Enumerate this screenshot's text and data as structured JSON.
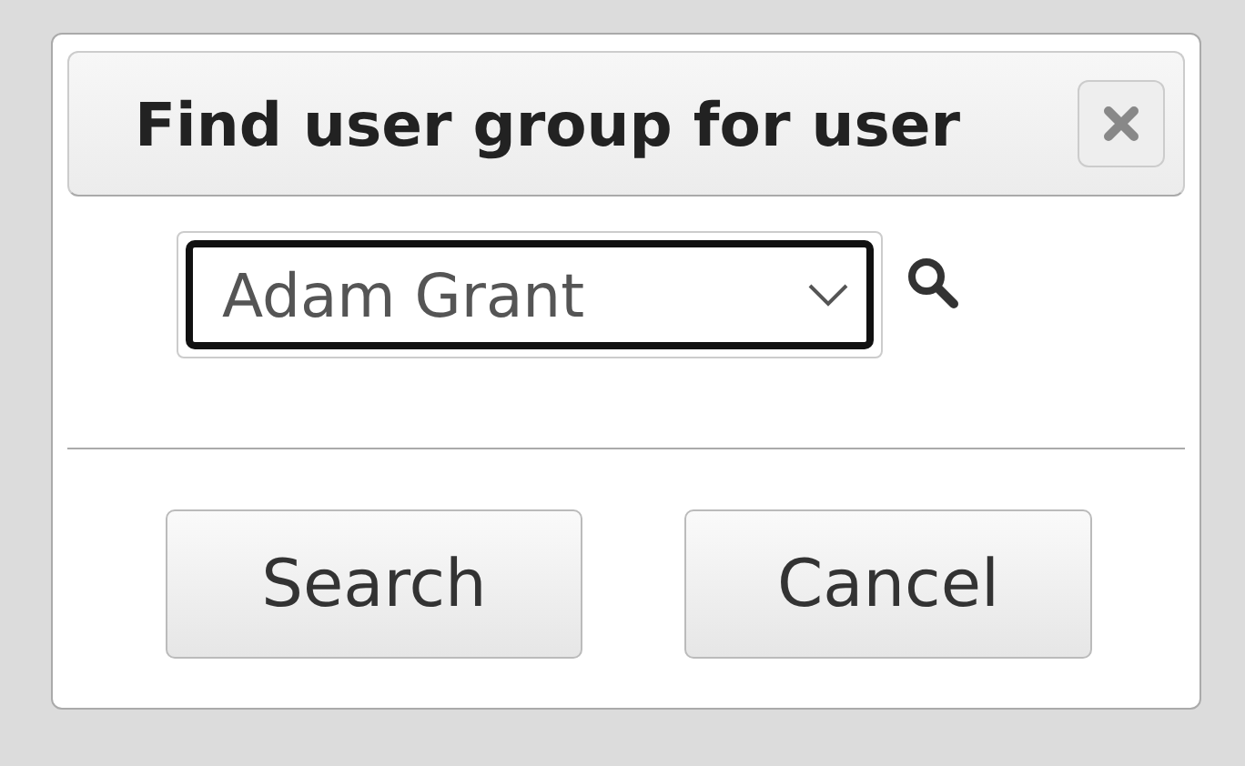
{
  "dialog": {
    "title": "Find user group for user"
  },
  "user_select": {
    "value": "Adam Grant",
    "focused": true
  },
  "buttons": [
    {
      "label": "Search"
    },
    {
      "label": "Cancel"
    }
  ]
}
